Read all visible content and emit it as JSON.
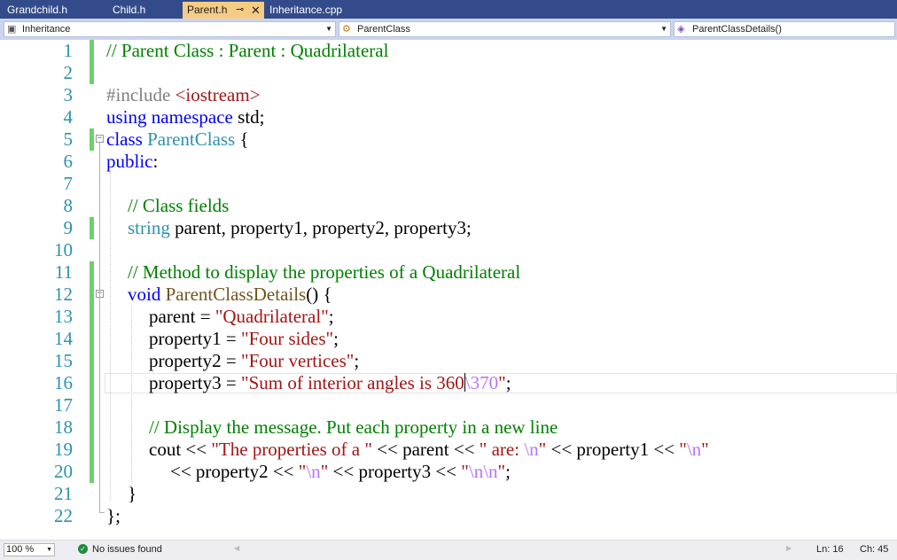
{
  "tabs": [
    {
      "label": "Grandchild.h"
    },
    {
      "label": "Child.h"
    },
    {
      "label": "Parent.h",
      "pin": "⊸",
      "close": "✕"
    },
    {
      "label": "Inheritance.cpp"
    }
  ],
  "nav": {
    "project": "Inheritance",
    "class_scope": "ParentClass",
    "member": "ParentClassDetails()"
  },
  "line_numbers": [
    "1",
    "2",
    "3",
    "4",
    "5",
    "6",
    "7",
    "8",
    "9",
    "10",
    "11",
    "12",
    "13",
    "14",
    "15",
    "16",
    "17",
    "18",
    "19",
    "20",
    "21",
    "22"
  ],
  "code": {
    "l1": {
      "comment": "// Parent Class : Parent : Quadrilateral"
    },
    "l3": {
      "directive": "#include",
      "header": "<iostream>"
    },
    "l4": {
      "kw_using": "using",
      "kw_namespace": "namespace",
      "rest": " std;"
    },
    "l5": {
      "kw": "class",
      "name": "ParentClass",
      "rest": " {"
    },
    "l6": {
      "kw": "public",
      "rest": ":"
    },
    "l8": {
      "comment": "// Class fields"
    },
    "l9": {
      "type": "string",
      "rest": " parent, property1, property2, property3;"
    },
    "l11": {
      "comment": "// Method to display the properties of a Quadrilateral"
    },
    "l12": {
      "kw": "void",
      "name": "ParentClassDetails",
      "rest": "() {"
    },
    "l13": {
      "lhs": "parent = ",
      "str": "\"Quadrilateral\"",
      "end": ";"
    },
    "l14": {
      "lhs": "property1 = ",
      "str": "\"Four sides\"",
      "end": ";"
    },
    "l15": {
      "lhs": "property2 = ",
      "str": "\"Four vertices\"",
      "end": ";"
    },
    "l16": {
      "lhs": "property3 = ",
      "str_a": "\"Sum of interior angles is 360",
      "esc": "\\370",
      "str_b": "\"",
      "end": ";"
    },
    "l18": {
      "comment": "// Display the message. Put each property in a new line"
    },
    "l19": {
      "a": "cout << ",
      "s1": "\"The properties of a \"",
      "b": " << parent << ",
      "s2a": "\" are: ",
      "e1": "\\n",
      "s2b": "\"",
      "c": " << property1 << ",
      "s3a": "\"",
      "e2": "\\n",
      "s3b": "\""
    },
    "l20": {
      "a": "<< property2 << ",
      "s1a": "\"",
      "e1": "\\n",
      "s1b": "\"",
      "b": " << property3 << ",
      "s2a": "\"",
      "e2": "\\n\\n",
      "s2b": "\"",
      "end": ";"
    },
    "l21": {
      "text": "}"
    },
    "l22": {
      "text": "};"
    }
  },
  "status": {
    "zoom": "100 %",
    "issues": "No issues found",
    "ln": "Ln: 16",
    "ch": "Ch: 45"
  },
  "colors": {
    "tab_bar": "#334b8a",
    "active_tab": "#f5cc84",
    "comment": "#008000",
    "keyword": "#0000ff",
    "type": "#2b91af",
    "function": "#74531f",
    "string": "#a31515",
    "escape": "#b776fb",
    "change_marker": "#6fcf6f"
  }
}
